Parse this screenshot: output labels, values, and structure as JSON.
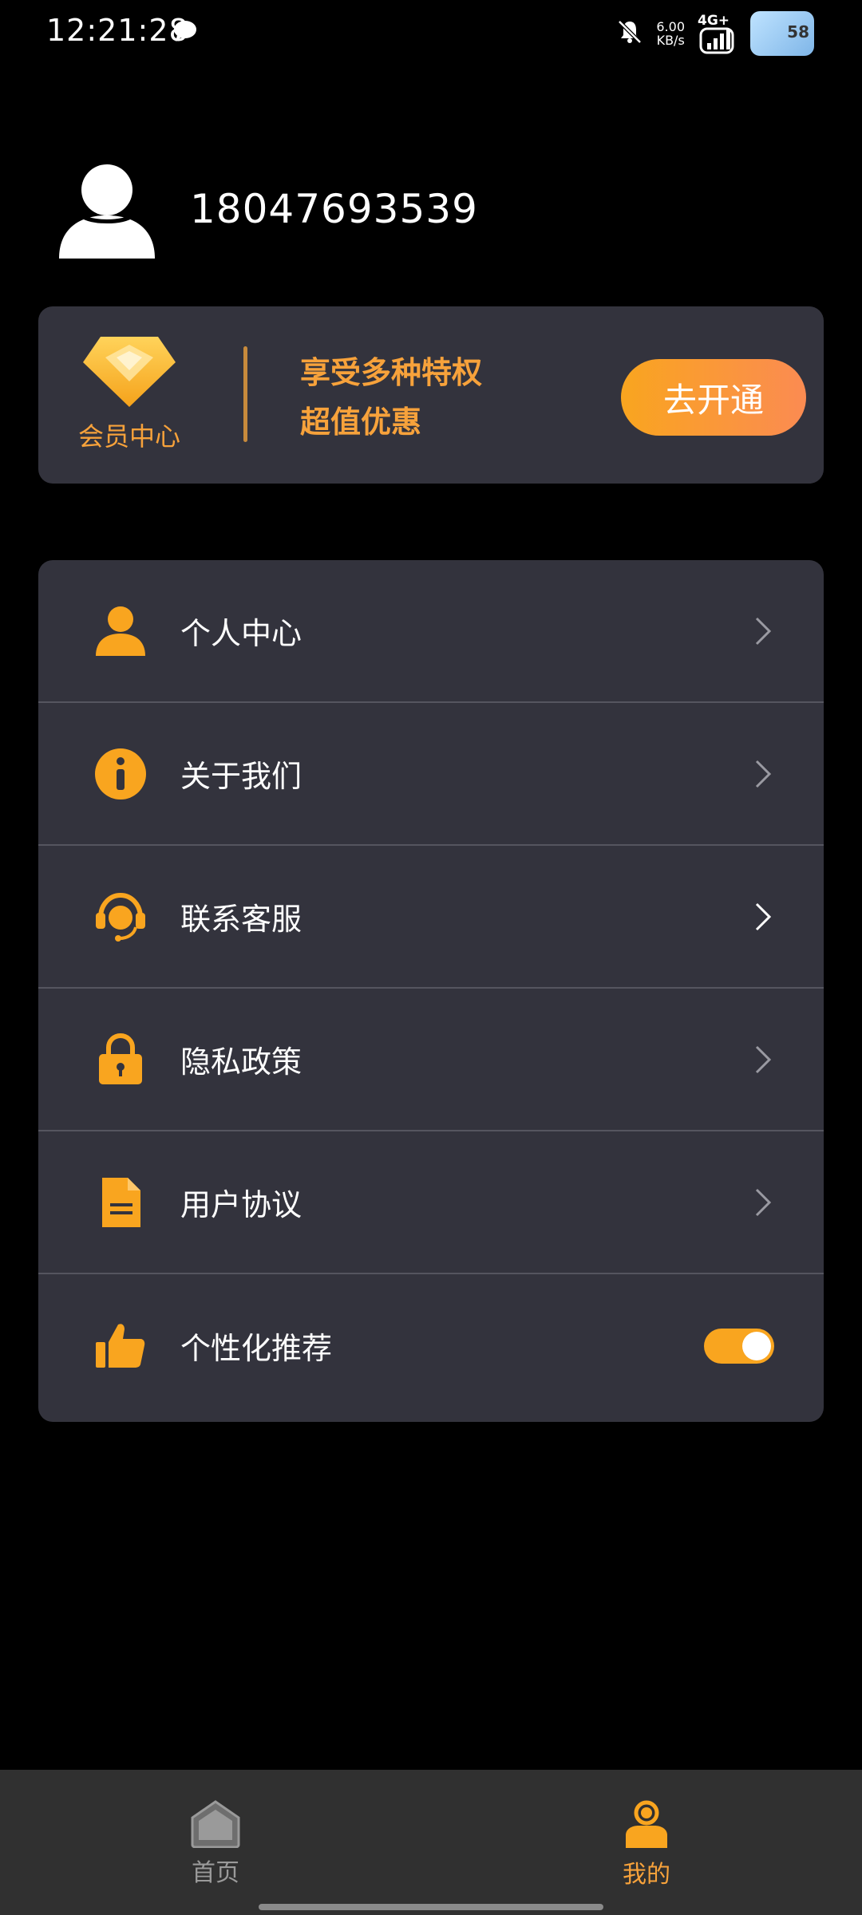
{
  "status_bar": {
    "time": "12:21:28",
    "net_speed_value": "6.00",
    "net_speed_unit": "KB/s",
    "network_type": "4G+",
    "avatar_badge": "58"
  },
  "profile": {
    "phone": "18047693539"
  },
  "vip": {
    "badge_label": "会员中心",
    "line1": "享受多种特权",
    "line2": "超值优惠",
    "button_label": "去开通",
    "accent_color": "#f7a23b"
  },
  "menu": {
    "items": [
      {
        "label": "个人中心",
        "icon": "person-icon"
      },
      {
        "label": "关于我们",
        "icon": "info-icon"
      },
      {
        "label": "联系客服",
        "icon": "headset-icon"
      },
      {
        "label": "隐私政策",
        "icon": "lock-icon"
      },
      {
        "label": "用户协议",
        "icon": "document-icon"
      },
      {
        "label": "个性化推荐",
        "icon": "thumbs-up-icon",
        "toggle_on": true
      }
    ]
  },
  "bottom_nav": {
    "home_label": "首页",
    "mine_label": "我的",
    "active": "我的"
  }
}
